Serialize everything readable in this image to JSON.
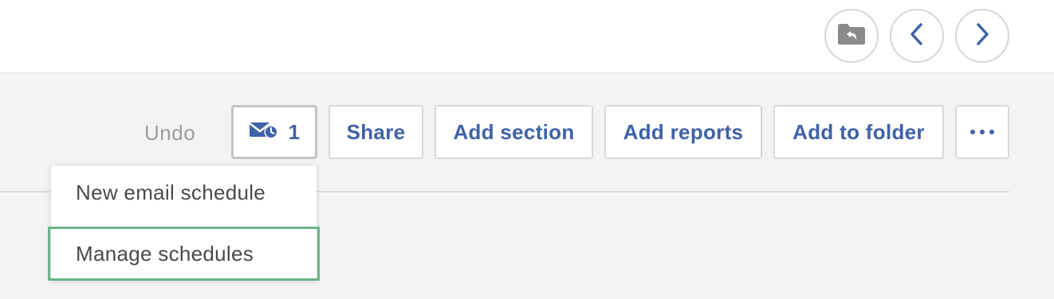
{
  "nav": {
    "folder_icon": "folder-back-icon",
    "prev_icon": "chevron-left-icon",
    "next_icon": "chevron-right-icon"
  },
  "toolbar": {
    "undo_label": "Undo",
    "schedule_icon": "email-schedule-icon",
    "schedule_count": "1",
    "share_label": "Share",
    "add_section_label": "Add section",
    "add_reports_label": "Add reports",
    "add_to_folder_label": "Add to folder",
    "more_icon": "more-dots-icon"
  },
  "dropdown": {
    "items": [
      {
        "label": "New email schedule"
      },
      {
        "label": "Manage schedules",
        "highlighted": true
      }
    ]
  },
  "colors": {
    "accent": "#3f62a8",
    "highlight_border": "#6bb48a",
    "icon_gray": "#8a8a8a",
    "muted_text": "#9c9c9c"
  }
}
